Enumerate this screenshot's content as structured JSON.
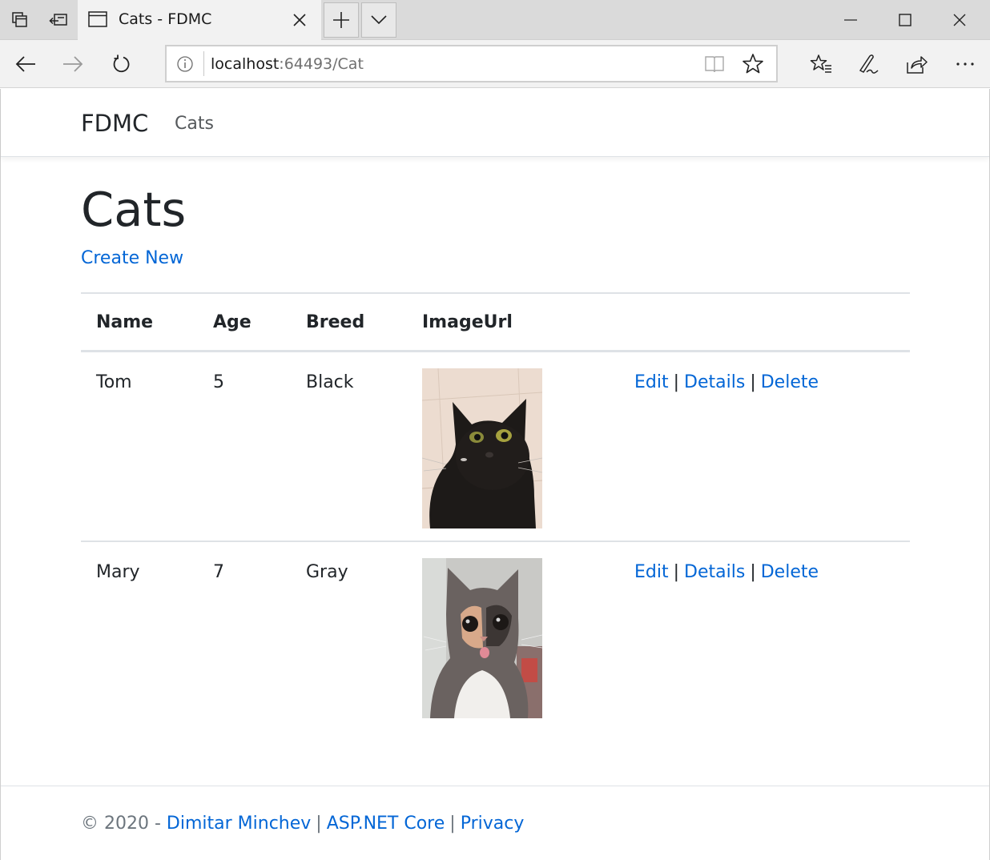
{
  "browser": {
    "tab_title": "Cats - FDMC",
    "url_host": "localhost",
    "url_rest": ":64493/Cat"
  },
  "site": {
    "brand": "FDMC",
    "nav_cats": "Cats"
  },
  "main": {
    "title": "Cats",
    "create_new": "Create New",
    "columns": [
      "Name",
      "Age",
      "Breed",
      "ImageUrl"
    ],
    "rows": [
      {
        "name": "Tom",
        "age": "5",
        "breed": "Black",
        "image": "black-cat-photo",
        "edit": "Edit",
        "details": "Details",
        "delete": "Delete",
        "sep": "|"
      },
      {
        "name": "Mary",
        "age": "7",
        "breed": "Gray",
        "image": "calico-cat-photo",
        "edit": "Edit",
        "details": "Details",
        "delete": "Delete",
        "sep": "|"
      }
    ]
  },
  "footer": {
    "copyright": "© 2020 -",
    "author": "Dimitar Minchev",
    "sep": "|",
    "framework": "ASP.NET Core",
    "privacy": "Privacy"
  },
  "colors": {
    "link": "#0366d6",
    "text": "#212529",
    "muted": "#6c757d",
    "border": "#dee2e6"
  }
}
